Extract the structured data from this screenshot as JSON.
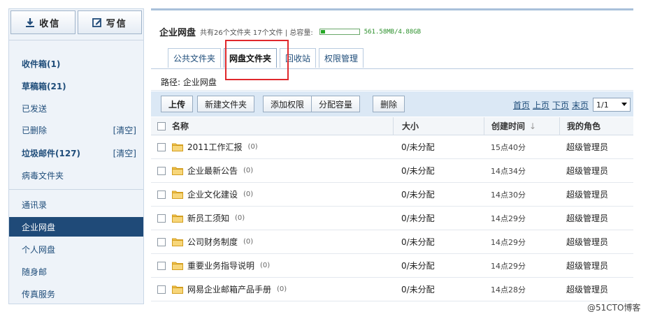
{
  "sidebar": {
    "receive_label": "收信",
    "compose_label": "写信",
    "items": [
      {
        "label": "收件箱(1)",
        "bold": true
      },
      {
        "label": "草稿箱(21)",
        "bold": true
      },
      {
        "label": "已发送",
        "bold": false
      },
      {
        "label": "已删除",
        "bold": false,
        "action": "[清空]"
      },
      {
        "label": "垃圾邮件(127)",
        "bold": true,
        "action": "[清空]"
      },
      {
        "label": "病毒文件夹",
        "bold": false
      },
      {
        "label": "通讯录",
        "bold": false
      },
      {
        "label": "企业网盘",
        "bold": false,
        "active": true
      },
      {
        "label": "个人网盘",
        "bold": false
      },
      {
        "label": "随身邮",
        "bold": false
      },
      {
        "label": "传真服务",
        "bold": false
      }
    ]
  },
  "header": {
    "title": "企业网盘",
    "summary": "共有26个文件夹 17个文件 | 总容量:",
    "quota_text": "561.58MB/4.88GB",
    "quota_fraction": 0.112
  },
  "tabs": [
    {
      "label": "公共文件夹",
      "active": false
    },
    {
      "label": "网盘文件夹",
      "active": true
    },
    {
      "label": "回收站",
      "active": false
    },
    {
      "label": "权限管理",
      "active": false
    }
  ],
  "path": "路径: 企业网盘",
  "toolbar": {
    "upload": "上传",
    "new_folder": "新建文件夹",
    "add_permission": "添加权限",
    "assign_quota": "分配容量",
    "delete": "删除"
  },
  "pager": {
    "first": "首页",
    "prev": "上页",
    "next": "下页",
    "last": "末页",
    "current": "1/1"
  },
  "table": {
    "headers": {
      "name": "名称",
      "size": "大小",
      "created": "创建时间",
      "role": "我的角色"
    },
    "rows": [
      {
        "name": "2011工作汇报",
        "count": "(0)",
        "size": "0/未分配",
        "created": "15点40分",
        "role": "超级管理员"
      },
      {
        "name": "企业最新公告",
        "count": "(0)",
        "size": "0/未分配",
        "created": "14点34分",
        "role": "超级管理员"
      },
      {
        "name": "企业文化建设",
        "count": "(0)",
        "size": "0/未分配",
        "created": "14点30分",
        "role": "超级管理员"
      },
      {
        "name": "新员工须知",
        "count": "(0)",
        "size": "0/未分配",
        "created": "14点29分",
        "role": "超级管理员"
      },
      {
        "name": "公司财务制度",
        "count": "(0)",
        "size": "0/未分配",
        "created": "14点29分",
        "role": "超级管理员"
      },
      {
        "name": "重要业务指导说明",
        "count": "(0)",
        "size": "0/未分配",
        "created": "14点29分",
        "role": "超级管理员"
      },
      {
        "name": "网易企业邮箱产品手册",
        "count": "(0)",
        "size": "0/未分配",
        "created": "14点28分",
        "role": "超级管理员"
      }
    ]
  },
  "watermark": "@51CTO博客",
  "colors": {
    "accent": "#1f4a78",
    "link": "#1f4d7a",
    "highlight": "#e0282c",
    "quota": "#27a827",
    "folder": "#f2c24b"
  }
}
